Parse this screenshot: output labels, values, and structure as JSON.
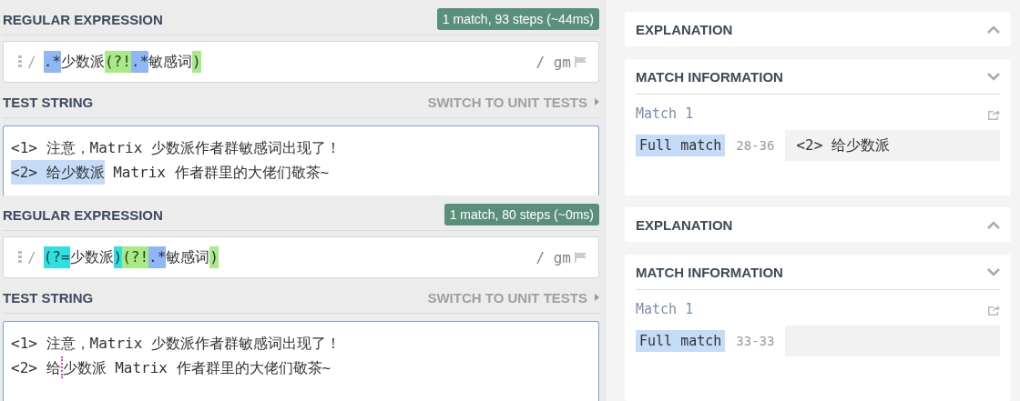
{
  "panels": [
    {
      "regex_title": "REGULAR EXPRESSION",
      "result_badge": "1 match, 93 steps (~44ms)",
      "delimiter_open": "/",
      "regex_tokens": [
        {
          "text": ".*",
          "kind": "quantifier"
        },
        {
          "text": "少数派",
          "kind": "plain"
        },
        {
          "text": "(?!",
          "kind": "group"
        },
        {
          "text": ".*",
          "kind": "quantifier"
        },
        {
          "text": "敏感词",
          "kind": "plain"
        },
        {
          "text": ")",
          "kind": "group"
        }
      ],
      "flags": "/ gm",
      "test_title": "TEST STRING",
      "unit_tests_link": "SWITCH TO UNIT TESTS",
      "test_lines": [
        [
          {
            "text": "<1> 注意，Matrix 少数派作者群敏感词出现了！",
            "kind": "text"
          }
        ],
        [
          {
            "text": "<2> 给少数派",
            "kind": "match"
          },
          {
            "text": " Matrix 作者群里的大佬们敬茶~",
            "kind": "text"
          }
        ]
      ],
      "explanation": {
        "title": "EXPLANATION",
        "expanded": false
      },
      "match_info": {
        "title": "MATCH INFORMATION",
        "expanded": true,
        "match_label": "Match 1",
        "full_match_label": "Full match",
        "range": "28-36",
        "value": "<2> 给少数派"
      }
    },
    {
      "regex_title": "REGULAR EXPRESSION",
      "result_badge": "1 match, 80 steps (~0ms)",
      "delimiter_open": "/",
      "regex_tokens": [
        {
          "text": "(?=",
          "kind": "lookahead"
        },
        {
          "text": "少数派",
          "kind": "plain"
        },
        {
          "text": ")",
          "kind": "lookahead"
        },
        {
          "text": "(?!",
          "kind": "group"
        },
        {
          "text": ".*",
          "kind": "quantifier"
        },
        {
          "text": "敏感词",
          "kind": "plain"
        },
        {
          "text": ")",
          "kind": "group"
        }
      ],
      "flags": "/ gm",
      "test_title": "TEST STRING",
      "unit_tests_link": "SWITCH TO UNIT TESTS",
      "test_lines": [
        [
          {
            "text": "<1> 注意，Matrix 少数派作者群敏感词出现了！",
            "kind": "text"
          }
        ],
        [
          {
            "text": "<2> 给",
            "kind": "text"
          },
          {
            "kind": "empty_match"
          },
          {
            "text": "少数派 Matrix 作者群里的大佬们敬茶~",
            "kind": "text"
          }
        ]
      ],
      "explanation": {
        "title": "EXPLANATION",
        "expanded": false
      },
      "match_info": {
        "title": "MATCH INFORMATION",
        "expanded": true,
        "match_label": "Match 1",
        "full_match_label": "Full match",
        "range": "33-33"
      }
    }
  ]
}
